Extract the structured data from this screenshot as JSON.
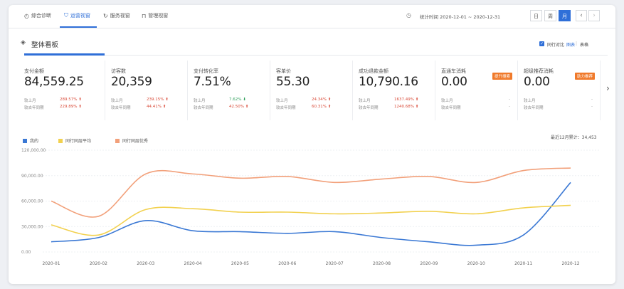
{
  "topnav": {
    "tabs": [
      {
        "label": "综合诊断",
        "icon": "gauge-icon"
      },
      {
        "label": "运营视窗",
        "icon": "shield-icon"
      },
      {
        "label": "服务视窗",
        "icon": "refresh-icon"
      },
      {
        "label": "管理视窗",
        "icon": "bag-icon"
      }
    ],
    "date_range": "统计时间 2020-12-01 ~ 2020-12-31",
    "range_buttons": [
      "日",
      "周",
      "月"
    ],
    "active_range": "月"
  },
  "section": {
    "title": "整体看板",
    "options": {
      "compare": "同行对比",
      "chart": "图表",
      "divider": "|",
      "table": "表格"
    }
  },
  "metrics": [
    {
      "label": "支付金额",
      "value": "84,559.25",
      "row1_label": "较上月",
      "row1_value": "289.57%",
      "row2_label": "较去年同期",
      "row2_value": "229.89%"
    },
    {
      "label": "访客数",
      "value": "20,359",
      "row1_label": "较上月",
      "row1_value": "239.15%",
      "row2_label": "较去年同期",
      "row2_value": "44.41%"
    },
    {
      "label": "支付转化率",
      "value": "7.51%",
      "row1_label": "较上月",
      "row1_value": "7.62%",
      "row2_label": "较去年同期",
      "row2_value": "42.50%"
    },
    {
      "label": "客单价",
      "value": "55.30",
      "row1_label": "较上月",
      "row1_value": "24.34%",
      "row2_label": "较去年同期",
      "row2_value": "60.31%"
    },
    {
      "label": "成功退款金额",
      "value": "10,790.16",
      "row1_label": "较上月",
      "row1_value": "1637.49%",
      "row2_label": "较去年同期",
      "row2_value": "1240.68%"
    },
    {
      "label": "直通车消耗",
      "value": "0.00",
      "badge": "提升搜索",
      "row1_label": "较上月",
      "row1_value": "-",
      "row2_label": "较去年同期",
      "row2_value": "-"
    },
    {
      "label": "超级推荐消耗",
      "value": "0.00",
      "badge": "助力推荐",
      "row1_label": "较上月",
      "row1_value": "-",
      "row2_label": "较去年同期",
      "row2_value": "-"
    }
  ],
  "chart_data": {
    "type": "line",
    "legend": [
      "我的",
      "同行同层平均",
      "同行同层优秀"
    ],
    "total_label": "最近12月累计：34,453",
    "categories": [
      "2020-01",
      "2020-02",
      "2020-03",
      "2020-04",
      "2020-05",
      "2020-06",
      "2020-07",
      "2020-08",
      "2020-09",
      "2020-10",
      "2020-11",
      "2020-12"
    ],
    "ylim": [
      0,
      120000
    ],
    "yticks": [
      "0.00",
      "30,000.00",
      "60,000.00",
      "90,000.00",
      "120,000.00"
    ],
    "series": [
      {
        "name": "我的",
        "color": "#3a78d4",
        "values": [
          12000,
          17000,
          37000,
          25000,
          24000,
          22000,
          24000,
          17000,
          12000,
          8000,
          20000,
          82000
        ]
      },
      {
        "name": "同行同层平均",
        "color": "#f2d14f",
        "values": [
          32000,
          20000,
          50000,
          51000,
          47000,
          47000,
          45000,
          46000,
          48000,
          45000,
          52000,
          55000
        ]
      },
      {
        "name": "同行同层优秀",
        "color": "#f2a07a",
        "values": [
          60000,
          42000,
          92000,
          92000,
          87000,
          89000,
          82000,
          86000,
          89000,
          82000,
          96000,
          99000
        ]
      }
    ]
  }
}
